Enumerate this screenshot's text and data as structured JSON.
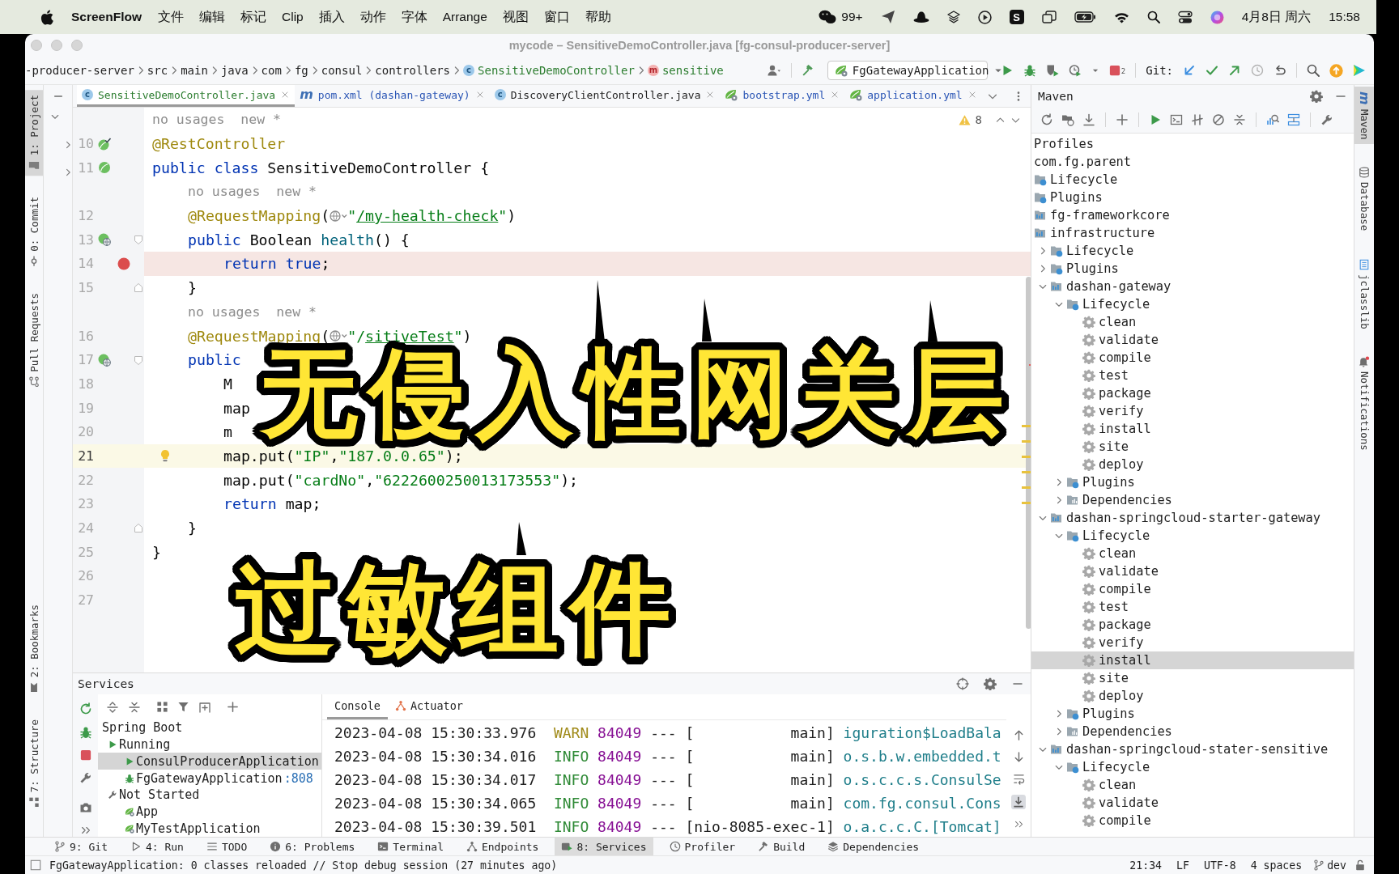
{
  "menu_bar": {
    "app_name": "ScreenFlow",
    "menus": [
      "文件",
      "编辑",
      "标记",
      "Clip",
      "插入",
      "动作",
      "字体",
      "Arrange",
      "视图",
      "窗口",
      "帮助"
    ],
    "message_count": "99+",
    "tile_letter": "S",
    "date": "4月8日 周六",
    "time": "15:58"
  },
  "window": {
    "title": "mycode – SensitiveDemoController.java [fg-consul-producer-server]"
  },
  "breadcrumb": [
    {
      "label": "-producer-server",
      "kind": "folder",
      "color": "#1e1e1e"
    },
    {
      "label": "src",
      "kind": "folder",
      "color": "#1e1e1e"
    },
    {
      "label": "main",
      "kind": "folder",
      "color": "#1e1e1e"
    },
    {
      "label": "java",
      "kind": "folder",
      "color": "#1e1e1e"
    },
    {
      "label": "com",
      "kind": "folder",
      "color": "#1e1e1e"
    },
    {
      "label": "fg",
      "kind": "folder",
      "color": "#1e1e1e"
    },
    {
      "label": "consul",
      "kind": "folder",
      "color": "#1e1e1e"
    },
    {
      "label": "controllers",
      "kind": "folder",
      "color": "#1e1e1e"
    },
    {
      "label": "SensitiveDemoController",
      "kind": "class",
      "icon_text": "c",
      "color": "#2c7d2f"
    },
    {
      "label": "sensitive",
      "kind": "method",
      "icon_text": "m",
      "color": "#2c7d2f"
    }
  ],
  "toolbar": {
    "run_configuration": "FgGatewayApplication",
    "stop_count": "2",
    "git_label": "Git:"
  },
  "left_tool_strip": {
    "top": [
      {
        "label": "1: Project",
        "kind": "project",
        "selected": true
      },
      {
        "label": "0: Commit",
        "kind": "commit",
        "selected": false
      },
      {
        "label": "Pull Requests",
        "kind": "pull-requests",
        "selected": false
      }
    ],
    "bottom": [
      {
        "label": "2: Bookmarks",
        "kind": "bookmarks",
        "selected": false
      },
      {
        "label": "7: Structure",
        "kind": "structure",
        "selected": false
      }
    ]
  },
  "editor_tabs": [
    {
      "label": "SensitiveDemoController.java",
      "kind": "class",
      "icon_text": "c",
      "color": "#2c7d2f",
      "selected": true
    },
    {
      "label": "pom.xml (dashan-gateway)",
      "kind": "maven",
      "icon_text": "m",
      "color": "#2a55b5",
      "selected": false
    },
    {
      "label": "DiscoveryClientController.java",
      "kind": "class",
      "icon_text": "c",
      "color": "#1e1e1e",
      "selected": false
    },
    {
      "label": "bootstrap.yml",
      "kind": "yaml",
      "color": "#2a55b5",
      "selected": false
    },
    {
      "label": "application.yml",
      "kind": "yaml",
      "color": "#2a55b5",
      "selected": false
    }
  ],
  "editor": {
    "warning_count": "8",
    "lines": [
      {
        "kind": "hint",
        "text": "no usages  new *"
      },
      {
        "kind": "code",
        "number": "10",
        "gutter": {
          "kind": "bean-check"
        },
        "breakpoint": false,
        "caret": false,
        "tokens": [
          {
            "kind": "annotation",
            "text": "@RestController"
          }
        ]
      },
      {
        "kind": "code",
        "number": "11",
        "gutter": {
          "kind": "bean"
        },
        "breakpoint": false,
        "caret": false,
        "tokens": [
          {
            "kind": "keyword",
            "text": "public class "
          },
          {
            "kind": "plain",
            "text": "SensitiveDemoController {"
          }
        ],
        "children": [
          {
            "kind": "hint",
            "text": "no usages  new *"
          },
          {
            "kind": "code",
            "number": "12",
            "breakpoint": false,
            "caret": false,
            "tokens": [
              {
                "kind": "annotation",
                "text": "@RequestMapping"
              },
              {
                "kind": "plain",
                "text": "("
              },
              {
                "kind": "inlay"
              },
              {
                "kind": "string",
                "text": "\""
              },
              {
                "kind": "link",
                "text": "/my-health-check"
              },
              {
                "kind": "string",
                "text": "\""
              },
              {
                "kind": "plain",
                "text": ")"
              }
            ]
          },
          {
            "kind": "code",
            "number": "13",
            "gutter": {
              "kind": "endpoint"
            },
            "fold": {
              "kind": "start"
            },
            "breakpoint": false,
            "caret": false,
            "tokens": [
              {
                "kind": "keyword",
                "text": "public "
              },
              {
                "kind": "plain",
                "text": "Boolean "
              },
              {
                "kind": "method",
                "text": "health"
              },
              {
                "kind": "plain",
                "text": "() {"
              }
            ],
            "children": [
              {
                "kind": "code",
                "number": "14",
                "breakpoint": true,
                "caret": false,
                "tokens": [
                  {
                    "kind": "keyword",
                    "text": "return true"
                  },
                  {
                    "kind": "plain",
                    "text": ";"
                  }
                ]
              }
            ]
          },
          {
            "kind": "code",
            "number": "15",
            "fold": {
              "kind": "end"
            },
            "breakpoint": false,
            "caret": false,
            "tokens": [
              {
                "kind": "plain",
                "text": "}"
              }
            ]
          },
          {
            "kind": "hint",
            "text": "no usages  new *"
          },
          {
            "kind": "code",
            "number": "16",
            "breakpoint": false,
            "caret": false,
            "tokens": [
              {
                "kind": "annotation",
                "text": "@RequestMapping"
              },
              {
                "kind": "plain",
                "text": "("
              },
              {
                "kind": "inlay"
              },
              {
                "kind": "string",
                "text": "\"/"
              },
              {
                "kind": "link",
                "text": "sitiveTest"
              },
              {
                "kind": "string",
                "text": "\""
              },
              {
                "kind": "plain",
                "text": ")"
              }
            ]
          },
          {
            "kind": "code",
            "number": "17",
            "gutter": {
              "kind": "endpoint"
            },
            "fold": {
              "kind": "start"
            },
            "breakpoint": false,
            "caret": false,
            "tokens": [
              {
                "kind": "keyword",
                "text": "public"
              }
            ],
            "children": [
              {
                "kind": "code",
                "number": "18",
                "breakpoint": false,
                "caret": false,
                "tokens": [
                  {
                    "kind": "plain",
                    "text": "M"
                  }
                ]
              },
              {
                "kind": "code",
                "number": "19",
                "breakpoint": false,
                "caret": false,
                "tokens": [
                  {
                    "kind": "plain",
                    "text": "map"
                  }
                ]
              },
              {
                "kind": "code",
                "number": "20",
                "breakpoint": false,
                "caret": false,
                "tokens": [
                  {
                    "kind": "plain",
                    "text": "m"
                  }
                ]
              },
              {
                "kind": "code",
                "number": "21",
                "breakpoint": false,
                "caret": true,
                "intention": true,
                "tokens": [
                  {
                    "kind": "plain",
                    "text": "map.put("
                  },
                  {
                    "kind": "string",
                    "text": "\"IP\""
                  },
                  {
                    "kind": "plain",
                    "text": ","
                  },
                  {
                    "kind": "string",
                    "text": "\"187.0.0.65\""
                  },
                  {
                    "kind": "plain",
                    "text": ");"
                  }
                ]
              },
              {
                "kind": "code",
                "number": "22",
                "breakpoint": false,
                "caret": false,
                "tokens": [
                  {
                    "kind": "plain",
                    "text": "map.put("
                  },
                  {
                    "kind": "string",
                    "text": "\"cardNo\""
                  },
                  {
                    "kind": "plain",
                    "text": ","
                  },
                  {
                    "kind": "string",
                    "text": "\"6222600250013173553\""
                  },
                  {
                    "kind": "plain",
                    "text": ");"
                  }
                ]
              },
              {
                "kind": "code",
                "number": "23",
                "breakpoint": false,
                "caret": false,
                "tokens": [
                  {
                    "kind": "keyword",
                    "text": "return "
                  },
                  {
                    "kind": "plain",
                    "text": "map;"
                  }
                ]
              }
            ]
          },
          {
            "kind": "code",
            "number": "24",
            "fold": {
              "kind": "end"
            },
            "breakpoint": false,
            "caret": false,
            "tokens": [
              {
                "kind": "plain",
                "text": "}"
              }
            ]
          }
        ]
      },
      {
        "kind": "code",
        "number": "25",
        "breakpoint": false,
        "caret": false,
        "tokens": [
          {
            "kind": "plain",
            "text": "}"
          }
        ]
      },
      {
        "kind": "code",
        "number": "26",
        "breakpoint": false,
        "caret": false
      },
      {
        "kind": "code",
        "number": "27",
        "breakpoint": false,
        "caret": false
      }
    ]
  },
  "overlay_caption": {
    "lines": [
      "无侵入性网关层",
      "过敏组件"
    ]
  },
  "maven": {
    "title": "Maven",
    "tree": [
      {
        "label": "Profiles",
        "kind": "root",
        "selected": false
      },
      {
        "label": "com.fg.parent",
        "kind": "root",
        "selected": false,
        "children": [
          {
            "label": "Lifecycle",
            "kind": "lifecycle",
            "selected": false
          },
          {
            "label": "Plugins",
            "kind": "plugins",
            "selected": false
          },
          {
            "label": "fg-frameworkcore",
            "kind": "module",
            "selected": false
          },
          {
            "label": "infrastructure",
            "kind": "module",
            "selected": false,
            "children": [
              {
                "label": "Lifecycle",
                "kind": "lifecycle",
                "expanded": false,
                "selected": false
              },
              {
                "label": "Plugins",
                "kind": "plugins",
                "expanded": false,
                "selected": false
              },
              {
                "label": "dashan-gateway",
                "kind": "module",
                "expanded": true,
                "selected": false,
                "children": [
                  {
                    "label": "Lifecycle",
                    "kind": "lifecycle",
                    "expanded": true,
                    "selected": false,
                    "children": [
                      {
                        "label": "clean",
                        "kind": "goal",
                        "selected": false
                      },
                      {
                        "label": "validate",
                        "kind": "goal",
                        "selected": false
                      },
                      {
                        "label": "compile",
                        "kind": "goal",
                        "selected": false
                      },
                      {
                        "label": "test",
                        "kind": "goal",
                        "selected": false
                      },
                      {
                        "label": "package",
                        "kind": "goal",
                        "selected": false
                      },
                      {
                        "label": "verify",
                        "kind": "goal",
                        "selected": false
                      },
                      {
                        "label": "install",
                        "kind": "goal",
                        "selected": false
                      },
                      {
                        "label": "site",
                        "kind": "goal",
                        "selected": false
                      },
                      {
                        "label": "deploy",
                        "kind": "goal",
                        "selected": false
                      }
                    ]
                  },
                  {
                    "label": "Plugins",
                    "kind": "plugins",
                    "expanded": false,
                    "selected": false
                  },
                  {
                    "label": "Dependencies",
                    "kind": "dependencies",
                    "expanded": false,
                    "selected": false
                  }
                ]
              },
              {
                "label": "dashan-springcloud-starter-gateway",
                "kind": "module",
                "expanded": true,
                "selected": false,
                "children": [
                  {
                    "label": "Lifecycle",
                    "kind": "lifecycle",
                    "expanded": true,
                    "selected": false,
                    "children": [
                      {
                        "label": "clean",
                        "kind": "goal",
                        "selected": false
                      },
                      {
                        "label": "validate",
                        "kind": "goal",
                        "selected": false
                      },
                      {
                        "label": "compile",
                        "kind": "goal",
                        "selected": false
                      },
                      {
                        "label": "test",
                        "kind": "goal",
                        "selected": false
                      },
                      {
                        "label": "package",
                        "kind": "goal",
                        "selected": false
                      },
                      {
                        "label": "verify",
                        "kind": "goal",
                        "selected": false
                      },
                      {
                        "label": "install",
                        "kind": "goal",
                        "selected": true
                      },
                      {
                        "label": "site",
                        "kind": "goal",
                        "selected": false
                      },
                      {
                        "label": "deploy",
                        "kind": "goal",
                        "selected": false
                      }
                    ]
                  },
                  {
                    "label": "Plugins",
                    "kind": "plugins",
                    "expanded": false,
                    "selected": false
                  },
                  {
                    "label": "Dependencies",
                    "kind": "dependencies",
                    "expanded": false,
                    "selected": false
                  }
                ]
              },
              {
                "label": "dashan-springcloud-stater-sensitive",
                "kind": "module",
                "expanded": true,
                "selected": false,
                "children": [
                  {
                    "label": "Lifecycle",
                    "kind": "lifecycle",
                    "expanded": true,
                    "selected": false,
                    "children": [
                      {
                        "label": "clean",
                        "kind": "goal",
                        "selected": false
                      },
                      {
                        "label": "validate",
                        "kind": "goal",
                        "selected": false
                      },
                      {
                        "label": "compile",
                        "kind": "goal",
                        "selected": false
                      }
                    ]
                  }
                ]
              }
            ]
          }
        ]
      }
    ]
  },
  "right_tool_strip": [
    {
      "label": "Maven",
      "kind": "maven",
      "icon_text": "m",
      "selected": true
    },
    {
      "label": "Database",
      "kind": "database",
      "selected": false
    },
    {
      "label": "jclasslib",
      "kind": "jclasslib",
      "selected": false
    },
    {
      "label": "Notifications",
      "kind": "notifications",
      "selected": false
    }
  ],
  "services": {
    "title": "Services",
    "tree": [
      {
        "label": "Spring Boot",
        "kind": "group",
        "selected": false,
        "children": [
          {
            "label": "Running",
            "kind": "running",
            "selected": false,
            "children": [
              {
                "label": "ConsulProducerApplication",
                "kind": "app-running",
                "selected": true
              },
              {
                "label": "FgGatewayApplication",
                "port": ":808",
                "kind": "app-debug",
                "selected": false
              }
            ]
          },
          {
            "label": "Not Started",
            "kind": "not-started",
            "selected": false,
            "children": [
              {
                "label": "App",
                "kind": "app-idle",
                "selected": false
              },
              {
                "label": "MyTestApplication",
                "kind": "app-idle",
                "selected": false
              }
            ]
          }
        ]
      }
    ],
    "console_tabs": [
      {
        "label": "Console",
        "kind": "console",
        "selected": true
      },
      {
        "label": "Actuator",
        "kind": "actuator",
        "selected": false
      }
    ],
    "console_lines": [
      {
        "time": "2023-04-08 15:30:33.976",
        "kind": "warn",
        "level": "WARN",
        "pid": "84049",
        "separator": "---",
        "thread": "[           main]",
        "logger": "iguration$LoadBala"
      },
      {
        "time": "2023-04-08 15:30:34.016",
        "kind": "info",
        "level": "INFO",
        "pid": "84049",
        "separator": "---",
        "thread": "[           main]",
        "logger": "o.s.b.w.embedded.t"
      },
      {
        "time": "2023-04-08 15:30:34.017",
        "kind": "info",
        "level": "INFO",
        "pid": "84049",
        "separator": "---",
        "thread": "[           main]",
        "logger": "o.s.c.c.s.ConsulSe"
      },
      {
        "time": "2023-04-08 15:30:34.065",
        "kind": "info",
        "level": "INFO",
        "pid": "84049",
        "separator": "---",
        "thread": "[           main]",
        "logger": "com.fg.consul.Cons"
      },
      {
        "time": "2023-04-08 15:30:39.501",
        "kind": "info",
        "level": "INFO",
        "pid": "84049",
        "separator": "---",
        "thread": "[nio-8085-exec-1]",
        "logger": "o.a.c.c.C.[Tomcat]"
      }
    ]
  },
  "bottom_tool_bar": [
    {
      "label": "9: Git",
      "kind": "git",
      "selected": false
    },
    {
      "label": "4: Run",
      "kind": "run",
      "selected": false
    },
    {
      "label": "TODO",
      "kind": "todo",
      "selected": false
    },
    {
      "label": "6: Problems",
      "kind": "problems",
      "selected": false
    },
    {
      "label": "Terminal",
      "kind": "terminal",
      "selected": false
    },
    {
      "label": "Endpoints",
      "kind": "endpoints",
      "selected": false
    },
    {
      "label": "8: Services",
      "kind": "services",
      "selected": true
    },
    {
      "label": "Profiler",
      "kind": "profiler",
      "selected": false
    },
    {
      "label": "Build",
      "kind": "build",
      "selected": false
    },
    {
      "label": "Dependencies",
      "kind": "dependencies",
      "selected": false
    }
  ],
  "status_bar": {
    "message": "FgGatewayApplication: 0 classes reloaded // Stop debug session (27 minutes ago)",
    "position": "21:34",
    "line_separator": "LF",
    "encoding": "UTF-8",
    "indent": "4 spaces",
    "branch": "dev"
  }
}
